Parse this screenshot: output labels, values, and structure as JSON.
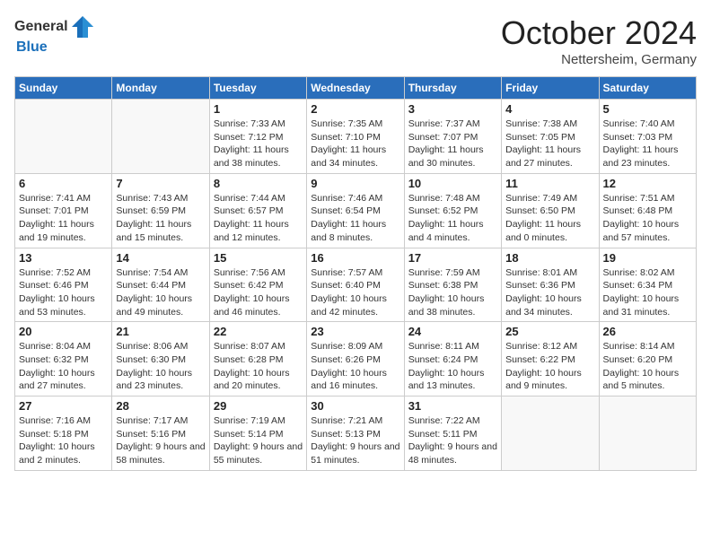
{
  "logo": {
    "general": "General",
    "blue": "Blue"
  },
  "title": {
    "month": "October 2024",
    "location": "Nettersheim, Germany"
  },
  "headers": [
    "Sunday",
    "Monday",
    "Tuesday",
    "Wednesday",
    "Thursday",
    "Friday",
    "Saturday"
  ],
  "weeks": [
    [
      {
        "day": "",
        "info": ""
      },
      {
        "day": "",
        "info": ""
      },
      {
        "day": "1",
        "info": "Sunrise: 7:33 AM\nSunset: 7:12 PM\nDaylight: 11 hours and 38 minutes."
      },
      {
        "day": "2",
        "info": "Sunrise: 7:35 AM\nSunset: 7:10 PM\nDaylight: 11 hours and 34 minutes."
      },
      {
        "day": "3",
        "info": "Sunrise: 7:37 AM\nSunset: 7:07 PM\nDaylight: 11 hours and 30 minutes."
      },
      {
        "day": "4",
        "info": "Sunrise: 7:38 AM\nSunset: 7:05 PM\nDaylight: 11 hours and 27 minutes."
      },
      {
        "day": "5",
        "info": "Sunrise: 7:40 AM\nSunset: 7:03 PM\nDaylight: 11 hours and 23 minutes."
      }
    ],
    [
      {
        "day": "6",
        "info": "Sunrise: 7:41 AM\nSunset: 7:01 PM\nDaylight: 11 hours and 19 minutes."
      },
      {
        "day": "7",
        "info": "Sunrise: 7:43 AM\nSunset: 6:59 PM\nDaylight: 11 hours and 15 minutes."
      },
      {
        "day": "8",
        "info": "Sunrise: 7:44 AM\nSunset: 6:57 PM\nDaylight: 11 hours and 12 minutes."
      },
      {
        "day": "9",
        "info": "Sunrise: 7:46 AM\nSunset: 6:54 PM\nDaylight: 11 hours and 8 minutes."
      },
      {
        "day": "10",
        "info": "Sunrise: 7:48 AM\nSunset: 6:52 PM\nDaylight: 11 hours and 4 minutes."
      },
      {
        "day": "11",
        "info": "Sunrise: 7:49 AM\nSunset: 6:50 PM\nDaylight: 11 hours and 0 minutes."
      },
      {
        "day": "12",
        "info": "Sunrise: 7:51 AM\nSunset: 6:48 PM\nDaylight: 10 hours and 57 minutes."
      }
    ],
    [
      {
        "day": "13",
        "info": "Sunrise: 7:52 AM\nSunset: 6:46 PM\nDaylight: 10 hours and 53 minutes."
      },
      {
        "day": "14",
        "info": "Sunrise: 7:54 AM\nSunset: 6:44 PM\nDaylight: 10 hours and 49 minutes."
      },
      {
        "day": "15",
        "info": "Sunrise: 7:56 AM\nSunset: 6:42 PM\nDaylight: 10 hours and 46 minutes."
      },
      {
        "day": "16",
        "info": "Sunrise: 7:57 AM\nSunset: 6:40 PM\nDaylight: 10 hours and 42 minutes."
      },
      {
        "day": "17",
        "info": "Sunrise: 7:59 AM\nSunset: 6:38 PM\nDaylight: 10 hours and 38 minutes."
      },
      {
        "day": "18",
        "info": "Sunrise: 8:01 AM\nSunset: 6:36 PM\nDaylight: 10 hours and 34 minutes."
      },
      {
        "day": "19",
        "info": "Sunrise: 8:02 AM\nSunset: 6:34 PM\nDaylight: 10 hours and 31 minutes."
      }
    ],
    [
      {
        "day": "20",
        "info": "Sunrise: 8:04 AM\nSunset: 6:32 PM\nDaylight: 10 hours and 27 minutes."
      },
      {
        "day": "21",
        "info": "Sunrise: 8:06 AM\nSunset: 6:30 PM\nDaylight: 10 hours and 23 minutes."
      },
      {
        "day": "22",
        "info": "Sunrise: 8:07 AM\nSunset: 6:28 PM\nDaylight: 10 hours and 20 minutes."
      },
      {
        "day": "23",
        "info": "Sunrise: 8:09 AM\nSunset: 6:26 PM\nDaylight: 10 hours and 16 minutes."
      },
      {
        "day": "24",
        "info": "Sunrise: 8:11 AM\nSunset: 6:24 PM\nDaylight: 10 hours and 13 minutes."
      },
      {
        "day": "25",
        "info": "Sunrise: 8:12 AM\nSunset: 6:22 PM\nDaylight: 10 hours and 9 minutes."
      },
      {
        "day": "26",
        "info": "Sunrise: 8:14 AM\nSunset: 6:20 PM\nDaylight: 10 hours and 5 minutes."
      }
    ],
    [
      {
        "day": "27",
        "info": "Sunrise: 7:16 AM\nSunset: 5:18 PM\nDaylight: 10 hours and 2 minutes."
      },
      {
        "day": "28",
        "info": "Sunrise: 7:17 AM\nSunset: 5:16 PM\nDaylight: 9 hours and 58 minutes."
      },
      {
        "day": "29",
        "info": "Sunrise: 7:19 AM\nSunset: 5:14 PM\nDaylight: 9 hours and 55 minutes."
      },
      {
        "day": "30",
        "info": "Sunrise: 7:21 AM\nSunset: 5:13 PM\nDaylight: 9 hours and 51 minutes."
      },
      {
        "day": "31",
        "info": "Sunrise: 7:22 AM\nSunset: 5:11 PM\nDaylight: 9 hours and 48 minutes."
      },
      {
        "day": "",
        "info": ""
      },
      {
        "day": "",
        "info": ""
      }
    ]
  ]
}
